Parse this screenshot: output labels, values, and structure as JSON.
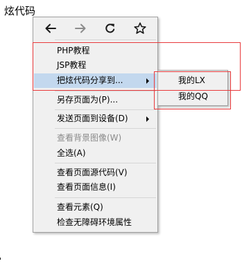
{
  "page": {
    "title": "炫代码"
  },
  "nav_bar": {
    "back_icon": "arrow-left",
    "forward_icon": "arrow-right",
    "reload_icon": "reload",
    "bookmark_icon": "star"
  },
  "menu": {
    "items": [
      {
        "label": "PHP教程"
      },
      {
        "label": "JSP教程"
      },
      {
        "label": "把炫代码分享到..."
      },
      {
        "label": "另存页面为(P)..."
      },
      {
        "label": "发送页面到设备(D)"
      },
      {
        "label": "查看背景图像(W)"
      },
      {
        "label": "全选(A)"
      },
      {
        "label": "查看页面源代码(V)"
      },
      {
        "label": "查看页面信息(I)"
      },
      {
        "label": "查看元素(Q)"
      },
      {
        "label": "检查无障碍环境属性"
      }
    ]
  },
  "submenu": {
    "items": [
      {
        "label": "我的LX"
      },
      {
        "label": "我的QQ"
      }
    ]
  },
  "colors": {
    "menu_bg": "#f0f0f0",
    "highlight": "#c3d8ee",
    "disabled_text": "#8a8a8a",
    "annotation_red": "#e8393b"
  }
}
